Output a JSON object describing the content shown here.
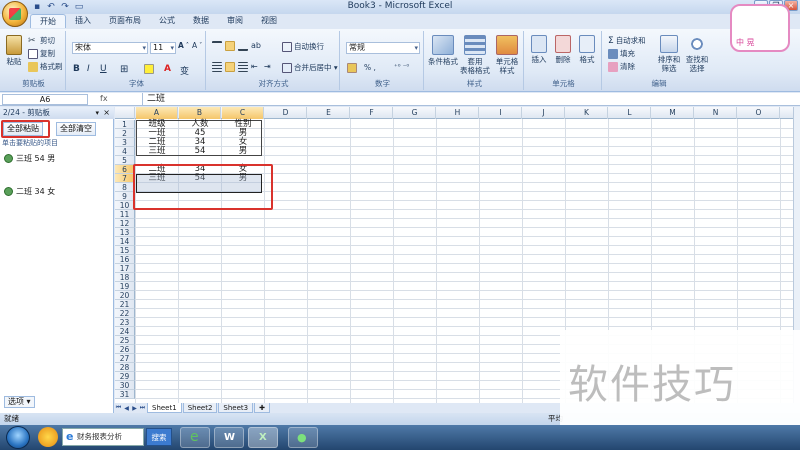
{
  "window": {
    "title": "Book3 - Microsoft Excel"
  },
  "tabs": [
    "开始",
    "插入",
    "页面布局",
    "公式",
    "数据",
    "审阅",
    "视图"
  ],
  "ribbon": {
    "clipboard": {
      "paste": "粘贴",
      "cut": "剪切",
      "copy": "复制",
      "format_painter": "格式刷",
      "label": "剪贴板"
    },
    "font": {
      "name": "宋体",
      "size": "11",
      "label": "字体"
    },
    "align": {
      "wrap": "自动换行",
      "merge": "合并后居中 ▾",
      "label": "对齐方式"
    },
    "number": {
      "format": "常规",
      "label": "数字",
      "percent": "% ,"
    },
    "styles": {
      "cond": "条件格式",
      "table": "套用\n表格格式",
      "cell": "单元格\n样式",
      "label": "样式"
    },
    "cells": {
      "insert": "插入",
      "delete": "删除",
      "format": "格式",
      "label": "单元格"
    },
    "edit": {
      "autosum": "自动求和",
      "fill": "填充",
      "clear": "清除",
      "sort": "排序和\n筛选",
      "find": "查找和\n选择",
      "label": "编辑"
    }
  },
  "formula_bar": {
    "name_box": "A6",
    "fx": "fx",
    "content": "二班"
  },
  "clipboard_pane": {
    "header": "2/24 - 剪贴板",
    "paste_all": "全部粘贴",
    "clear_all": "全部清空",
    "hint": "单击要粘贴的项目",
    "items": [
      "三班 54 男",
      "二班 34 女"
    ],
    "options": "选项 ▾"
  },
  "columns": [
    "A",
    "B",
    "C",
    "D",
    "E",
    "F",
    "G",
    "H",
    "I",
    "J",
    "K",
    "L",
    "M",
    "N",
    "O"
  ],
  "rows": [
    "1",
    "2",
    "3",
    "4",
    "5",
    "6",
    "7",
    "8",
    "9",
    "10",
    "11",
    "12",
    "13",
    "14",
    "15",
    "16",
    "17",
    "18",
    "19",
    "20",
    "21",
    "22",
    "23",
    "24",
    "25",
    "26",
    "27",
    "28",
    "29",
    "30",
    "31"
  ],
  "cells": {
    "r1": [
      "班级",
      "人数",
      "性别"
    ],
    "r2": [
      "一班",
      "45",
      "男"
    ],
    "r3": [
      "二班",
      "34",
      "女"
    ],
    "r4": [
      "三班",
      "54",
      "男"
    ],
    "r6": [
      "二班",
      "34",
      "女"
    ],
    "r7": [
      "三班",
      "54",
      "男"
    ]
  },
  "sheets": [
    "Sheet1",
    "Sheet2",
    "Sheet3"
  ],
  "status": {
    "left": "就绪",
    "right": "平均"
  },
  "taskbar": {
    "search_text": "财务报表分析",
    "search_btn": "搜索"
  },
  "watermark": "软件技巧",
  "mascot": "中 晃"
}
